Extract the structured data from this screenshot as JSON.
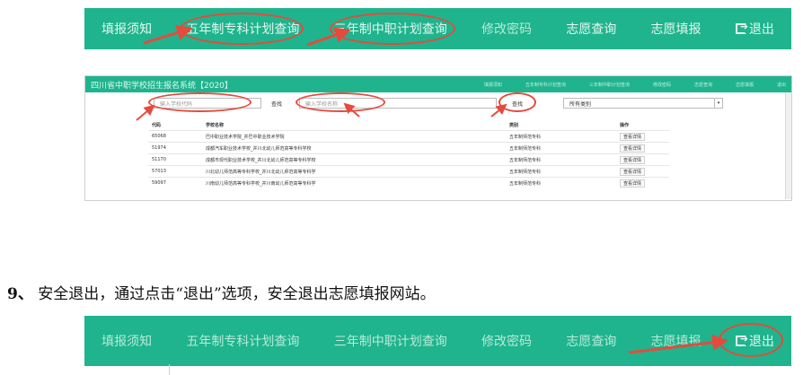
{
  "top_nav": {
    "items": [
      {
        "label": "填报须知",
        "dim": false
      },
      {
        "label": "五年制专科计划查询",
        "dim": false
      },
      {
        "label": "三年制中职计划查询",
        "dim": false
      },
      {
        "label": "修改密码",
        "dim": true
      },
      {
        "label": "志愿查询",
        "dim": false
      },
      {
        "label": "志愿填报",
        "dim": false
      },
      {
        "label": "退出",
        "dim": false,
        "icon": "logout-icon"
      }
    ]
  },
  "panel": {
    "title": "四川省中职学校招生报名系统【2020】",
    "top_links": [
      "填报须知",
      "五年制专科计划查询",
      "三年制中职计划查询",
      "修改密码",
      "志愿查询",
      "志愿填报",
      "退出"
    ],
    "code_placeholder": "输入学校代码",
    "search_label_1": "查找",
    "name_placeholder": "输入学校名称",
    "search_label_2": "查找",
    "category_selected": "所有类别",
    "table": {
      "headers": [
        "代码",
        "学校名称",
        "类别",
        "操作"
      ],
      "rows": [
        {
          "code": "65068",
          "name": "巴中职业技术学院_并巴中职业技术学院",
          "category": "五年制师范专科",
          "action": "查看详情"
        },
        {
          "code": "51974",
          "name": "成都汽车职业技术学校_并川北幼儿师范高等专科学校",
          "category": "五年制师范专科",
          "action": "查看详情"
        },
        {
          "code": "51170",
          "name": "成都市现代职业技术学校_并川北幼儿师范高等专科学校",
          "category": "五年制师范专科",
          "action": "查看详情"
        },
        {
          "code": "57013",
          "name": "川北幼儿师范高等专科学校_并川北幼儿师范高等专科学",
          "category": "五年制师范专科",
          "action": "查看详情"
        },
        {
          "code": "59097",
          "name": "川南幼儿师范高等专科学校_并川南幼儿师范高等专科学",
          "category": "五年制师范专科",
          "action": "查看详情"
        }
      ]
    }
  },
  "step": {
    "number": "9、",
    "text": "安全退出，通过点击“退出”选项，安全退出志愿填报网站。"
  },
  "bottom_nav": {
    "items": [
      {
        "label": "填报须知",
        "dim": true
      },
      {
        "label": "五年制专科计划查询",
        "dim": true
      },
      {
        "label": "三年制中职计划查询",
        "dim": true
      },
      {
        "label": "修改密码",
        "dim": true
      },
      {
        "label": "志愿查询",
        "dim": true
      },
      {
        "label": "志愿填报",
        "dim": true
      },
      {
        "label": "退出",
        "dim": false,
        "icon": "logout-icon"
      }
    ]
  },
  "colors": {
    "nav_green": "#1fb48d",
    "annotation_red": "#e64a3c"
  }
}
